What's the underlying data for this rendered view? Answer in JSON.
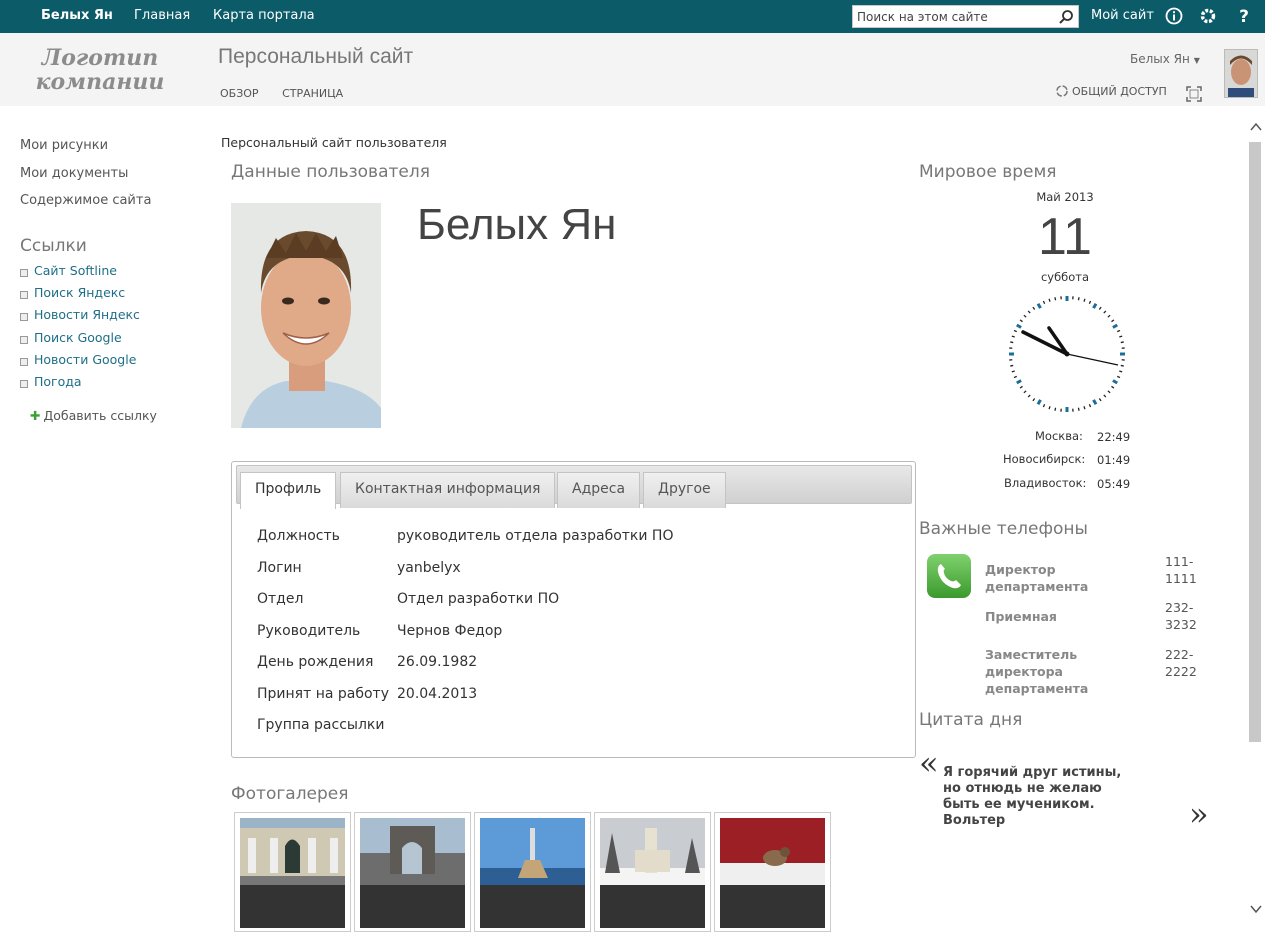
{
  "suitebar": {
    "user_name": "Белых Ян",
    "nav": [
      "Главная",
      "Карта портала"
    ],
    "search_placeholder": "Поиск на этом сайте",
    "my_site": "Мой сайт"
  },
  "header": {
    "logo_line1": "Логотип",
    "logo_line2": "компании",
    "site_title": "Персональный сайт",
    "tabs": [
      "ОБЗОР",
      "СТРАНИЦА"
    ],
    "user_menu": "Белых Ян",
    "share": "ОБЩИЙ ДОСТУП"
  },
  "leftnav": {
    "quick": [
      "Мои рисунки",
      "Мои документы",
      "Содержимое сайта"
    ],
    "links_title": "Ссылки",
    "links": [
      "Сайт Softline",
      "Поиск Яндекс",
      "Новости Яндекс",
      "Поиск Google",
      "Новости Google",
      "Погода"
    ],
    "add_link": "Добавить ссылку"
  },
  "main": {
    "breadcrumb": "Персональный сайт пользователя",
    "user_data_title": "Данные пользователя",
    "full_name": "Белых Ян",
    "tabs": [
      "Профиль",
      "Контактная информация",
      "Адреса",
      "Другое"
    ],
    "profile": [
      {
        "key": "Должность",
        "value": "руководитель отдела разработки ПО"
      },
      {
        "key": "Логин",
        "value": "yanbelyx"
      },
      {
        "key": "Отдел",
        "value": "Отдел разработки ПО"
      },
      {
        "key": "Руководитель",
        "value": "Чернов Федор"
      },
      {
        "key": "День рождения",
        "value": "26.09.1982"
      },
      {
        "key": "Принят на работу",
        "value": "20.04.2013"
      },
      {
        "key": "Группа рассылки",
        "value": ""
      }
    ],
    "gallery_title": "Фотогалерея"
  },
  "right": {
    "world_time_title": "Мировое время",
    "month_year": "Май 2013",
    "day": "11",
    "weekday": "суббота",
    "timezones": [
      {
        "city": "Москва:",
        "time": "22:49"
      },
      {
        "city": "Новосибирск:",
        "time": "01:49"
      },
      {
        "city": "Владивосток:",
        "time": "05:49"
      }
    ],
    "phones_title": "Важные телефоны",
    "phones": [
      {
        "name": "Директор департамента",
        "number_line1": "111-",
        "number_line2": "1111"
      },
      {
        "name": "Приемная",
        "number_line1": "232-",
        "number_line2": "3232"
      },
      {
        "name_line1": "Заместитель директора",
        "name_line2": "департамента",
        "number_line1": "222-",
        "number_line2": "2222"
      }
    ],
    "quote_title": "Цитата дня",
    "quote": "Я горячий друг истины, но отнюдь не желаю быть ее мучеником. Вольтер",
    "quote_open": "«",
    "quote_close": "»"
  },
  "colors": {
    "suitebar": "#0b5b69",
    "link": "#1e6f87",
    "header_bg": "#f4f4f4"
  }
}
